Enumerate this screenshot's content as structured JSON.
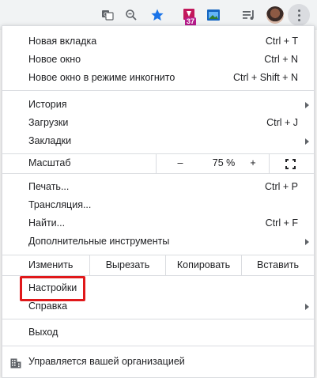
{
  "toolbar": {
    "icons": [
      "translate-icon",
      "zoom-icon",
      "bookmark-star-icon",
      "extension-icon",
      "screenshot-extension-icon",
      "media-control-icon",
      "profile-avatar",
      "more-menu-icon"
    ],
    "extension_badge": "37",
    "accent_color": "#1a73e8"
  },
  "menu": {
    "new_tab": {
      "label": "Новая вкладка",
      "shortcut": "Ctrl + T"
    },
    "new_window": {
      "label": "Новое окно",
      "shortcut": "Ctrl + N"
    },
    "incognito": {
      "label": "Новое окно в режиме инкогнито",
      "shortcut": "Ctrl + Shift + N"
    },
    "history": {
      "label": "История"
    },
    "downloads": {
      "label": "Загрузки",
      "shortcut": "Ctrl + J"
    },
    "bookmarks": {
      "label": "Закладки"
    },
    "zoom": {
      "label": "Масштаб",
      "minus": "–",
      "value": "75 %",
      "plus": "+"
    },
    "print": {
      "label": "Печать...",
      "shortcut": "Ctrl + P"
    },
    "cast": {
      "label": "Трансляция..."
    },
    "find": {
      "label": "Найти...",
      "shortcut": "Ctrl + F"
    },
    "more_tools": {
      "label": "Дополнительные инструменты"
    },
    "edit": {
      "label": "Изменить",
      "cut": "Вырезать",
      "copy": "Копировать",
      "paste": "Вставить"
    },
    "settings": {
      "label": "Настройки"
    },
    "help": {
      "label": "Справка"
    },
    "exit": {
      "label": "Выход"
    },
    "managed": {
      "label": "Управляется вашей организацией"
    }
  },
  "highlight_color": "#e0181a"
}
